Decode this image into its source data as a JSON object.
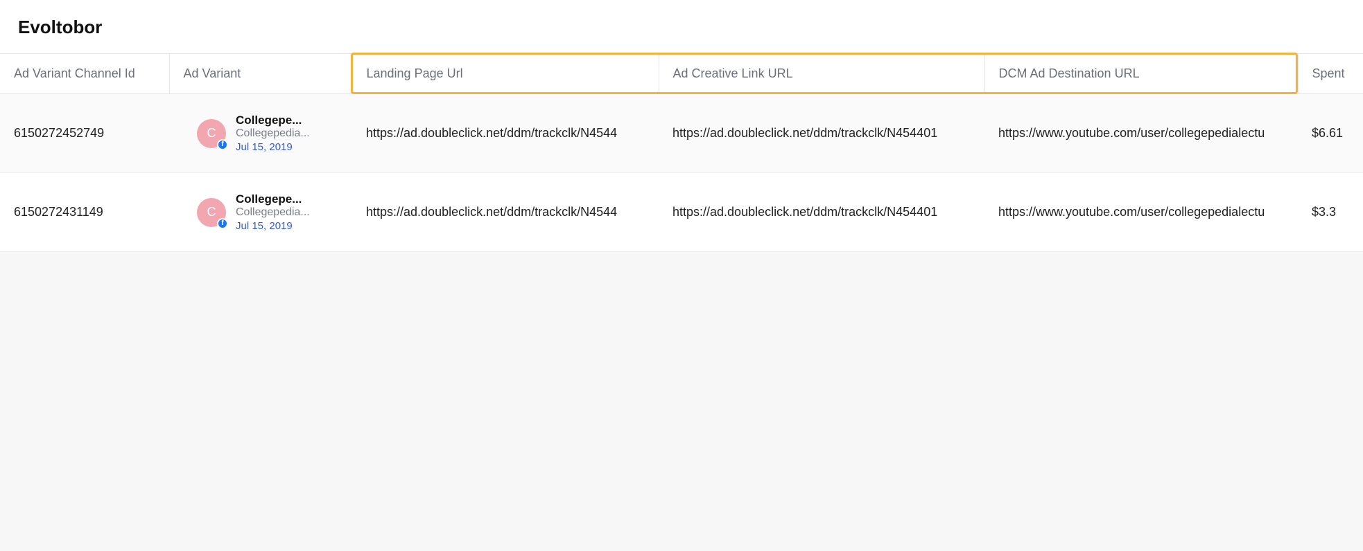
{
  "header": {
    "title": "Evoltobor"
  },
  "columns": {
    "id": "Ad Variant Channel Id",
    "variant": "Ad Variant",
    "landing": "Landing Page Url",
    "creative": "Ad Creative Link URL",
    "dcm": "DCM Ad Destination URL",
    "spent": "Spent"
  },
  "rows": [
    {
      "id": "6150272452749",
      "avatar_letter": "C",
      "title": "Collegepe...",
      "subtitle": "Collegepedia...",
      "date": "Jul 15, 2019",
      "landing": "https://ad.doubleclick.net/ddm/trackclk/N4544",
      "creative": "https://ad.doubleclick.net/ddm/trackclk/N454401",
      "dcm": "https://www.youtube.com/user/collegepedialectu",
      "spent": "$6.61"
    },
    {
      "id": "6150272431149",
      "avatar_letter": "C",
      "title": "Collegepe...",
      "subtitle": "Collegepedia...",
      "date": "Jul 15, 2019",
      "landing": "https://ad.doubleclick.net/ddm/trackclk/N4544",
      "creative": "https://ad.doubleclick.net/ddm/trackclk/N454401",
      "dcm": "https://www.youtube.com/user/collegepedialectu",
      "spent": "$3.3"
    }
  ]
}
